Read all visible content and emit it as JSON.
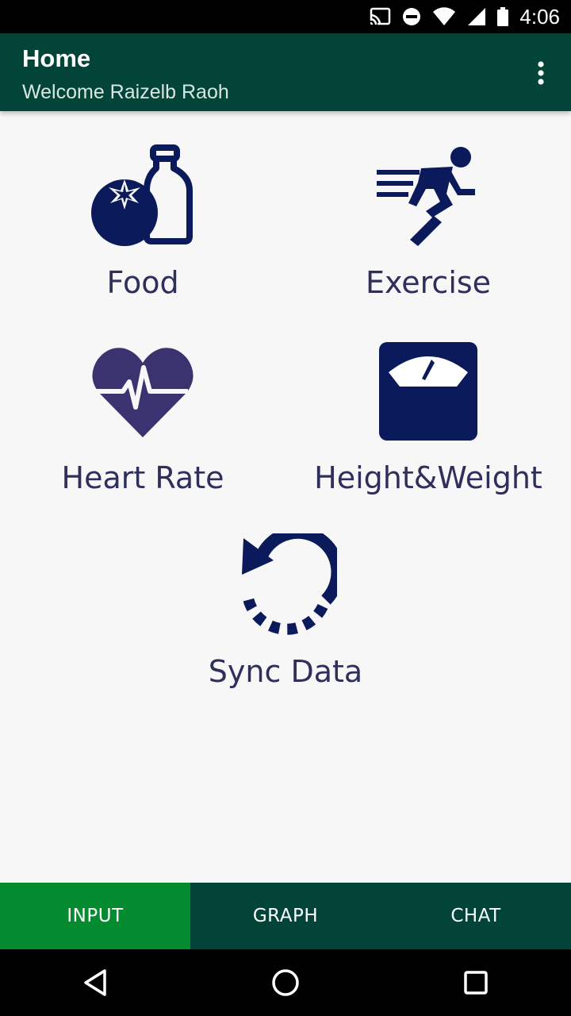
{
  "status_bar": {
    "time": "4:06",
    "icons": [
      "cast-icon",
      "do-not-disturb-icon",
      "wifi-icon",
      "cell-signal-icon",
      "battery-icon"
    ]
  },
  "app_bar": {
    "title": "Home",
    "subtitle": "Welcome Raizelb Raoh",
    "menu_icon": "more-vert-icon"
  },
  "tiles": [
    {
      "label": "Food",
      "icon": "food-icon"
    },
    {
      "label": "Exercise",
      "icon": "exercise-icon"
    },
    {
      "label": "Heart Rate",
      "icon": "heart-rate-icon"
    },
    {
      "label": "Height&Weight",
      "icon": "scale-icon"
    },
    {
      "label": "Sync Data",
      "icon": "sync-icon"
    }
  ],
  "bottom_tabs": [
    {
      "label": "INPUT",
      "active": true
    },
    {
      "label": "GRAPH",
      "active": false
    },
    {
      "label": "CHAT",
      "active": false
    }
  ],
  "nav_bar": {
    "icons": [
      "back-icon",
      "home-icon",
      "recents-icon"
    ]
  },
  "colors": {
    "app_bar": "#024538",
    "active_tab": "#048b2f",
    "icon_navy": "#0b1a5a",
    "heart": "#3a3370",
    "label": "#2f2f5c"
  }
}
